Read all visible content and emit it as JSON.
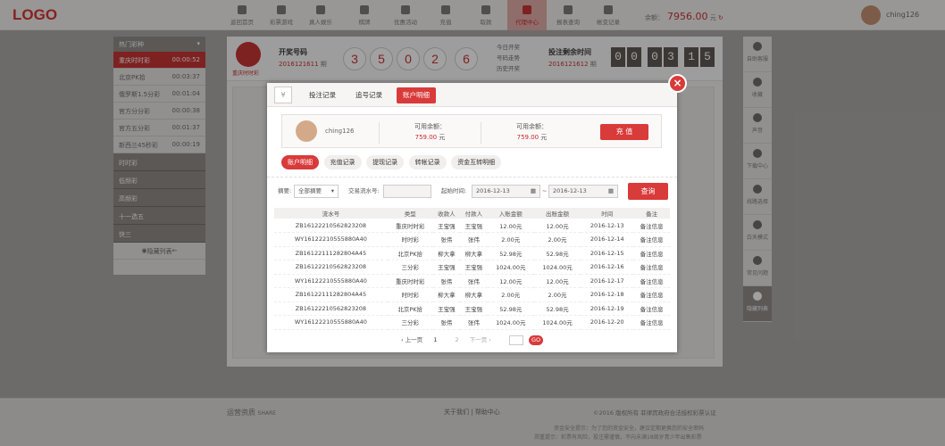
{
  "header": {
    "logo": "LOGO",
    "nav": [
      {
        "label": "返回首页"
      },
      {
        "label": "彩票游戏"
      },
      {
        "label": "真人娱乐"
      },
      {
        "label": "棋牌"
      },
      {
        "label": "优惠活动"
      },
      {
        "label": "充值"
      },
      {
        "label": "取款"
      },
      {
        "label": "代理中心",
        "active": true
      },
      {
        "label": "报表查询"
      },
      {
        "label": "帐变记录"
      }
    ],
    "balance_label": "余额：",
    "balance_value": "7956.00",
    "balance_unit": "元",
    "username": "ching126"
  },
  "sidebar": {
    "title": "热门彩种",
    "games": [
      {
        "name": "重庆时时彩",
        "time": "00:00:52",
        "active": true
      },
      {
        "name": "北京PK拾",
        "time": "00:03:37"
      },
      {
        "name": "俄罗斯1.5分彩",
        "time": "00:01:04"
      },
      {
        "name": "官方分分彩",
        "time": "00:00:38"
      },
      {
        "name": "官方五分彩",
        "time": "00:01:37"
      },
      {
        "name": "新西兰45秒彩",
        "time": "00:00:19"
      }
    ],
    "groups": [
      "时时彩",
      "低频彩",
      "高频彩",
      "十一选五",
      "快三"
    ],
    "hide_label": "隐藏列表"
  },
  "issue": {
    "game_name": "重庆时时彩",
    "draw_title": "开奖号码",
    "draw_no": "2016121611",
    "period": "期",
    "balls": [
      "3",
      "5",
      "0",
      "2",
      "6"
    ],
    "links": [
      "今日开奖",
      "号码走势",
      "历史开奖"
    ],
    "countdown_title": "投注剩余时间",
    "countdown_no": "2016121612",
    "countdown_period": "期",
    "countdown_digits": [
      "0",
      "0",
      "0",
      "3",
      "1",
      "5"
    ]
  },
  "right_panel": [
    {
      "label": "自助客服"
    },
    {
      "label": "收藏"
    },
    {
      "label": "声音"
    },
    {
      "label": "下载中心"
    },
    {
      "label": "线路选择"
    },
    {
      "label": "白天模式"
    },
    {
      "label": "常见问题"
    },
    {
      "label": "隐藏列表",
      "active": true
    }
  ],
  "modal": {
    "tabs": [
      {
        "label": "投注记录"
      },
      {
        "label": "追号记录"
      },
      {
        "label": "账户明细",
        "active": true
      }
    ],
    "close": "×",
    "account": {
      "name": "ching126",
      "available_label": "可用余额：",
      "available_value": "759.00",
      "unit": "元",
      "available2_label": "可用余额：",
      "available2_value": "759.00",
      "recharge_btn": "充 值"
    },
    "sub_tabs": [
      {
        "label": "账户明细",
        "active": true
      },
      {
        "label": "充值记录"
      },
      {
        "label": "提现记录"
      },
      {
        "label": "转帐记录"
      },
      {
        "label": "资金互转明细"
      }
    ],
    "filter": {
      "summary_label": "摘要:",
      "summary_value": "全部摘要",
      "txn_label": "交易流水号:",
      "date_label": "起始时间:",
      "date_from": "2016-12-13",
      "date_sep": "~",
      "date_to": "2016-12-13",
      "query_btn": "查询"
    },
    "table": {
      "headers": [
        "流水号",
        "类型",
        "收款人",
        "付款人",
        "入账金额",
        "出账金额",
        "时间",
        "备注"
      ],
      "rows": [
        [
          "ZB16122210562823208",
          "重庆时时彩",
          "王宝强",
          "王宝强",
          "12.00元",
          "12.00元",
          "2016-12-13",
          "备注信息"
        ],
        [
          "WY16122210555880A40",
          "时时彩",
          "张伟",
          "张伟",
          "2.00元",
          "2.00元",
          "2016-12-14",
          "备注信息"
        ],
        [
          "ZB16122111282804A45",
          "北京PK拾",
          "柳大拿",
          "柳大拿",
          "52.98元",
          "52.98元",
          "2016-12-15",
          "备注信息"
        ],
        [
          "ZB16122210562823208",
          "三分彩",
          "王宝强",
          "王宝强",
          "1024.00元",
          "1024.00元",
          "2016-12-16",
          "备注信息"
        ],
        [
          "WY16122210555880A40",
          "重庆时时彩",
          "张伟",
          "张伟",
          "12.00元",
          "12.00元",
          "2016-12-17",
          "备注信息"
        ],
        [
          "ZB16122111282804A45",
          "时时彩",
          "柳大拿",
          "柳大拿",
          "2.00元",
          "2.00元",
          "2016-12-18",
          "备注信息"
        ],
        [
          "ZB16122210562823208",
          "北京PK拾",
          "王宝强",
          "王宝强",
          "52.98元",
          "52.98元",
          "2016-12-19",
          "备注信息"
        ],
        [
          "WY16122210555880A40",
          "三分彩",
          "张伟",
          "张伟",
          "1024.00元",
          "1024.00元",
          "2016-12-20",
          "备注信息"
        ]
      ]
    },
    "pagination": {
      "prev": "‹ 上一页",
      "pages": [
        "1",
        "2"
      ],
      "next": "下一页 ›",
      "go": "GO"
    }
  },
  "footer": {
    "partners_title": "运营资质",
    "partners_sub": "SHARE",
    "links": [
      "关于我们",
      "帮助中心"
    ],
    "copyright": "©2016 版权所有 菲律宾政府合法授权彩票认证",
    "notice1": "资金安全提示：为了您的资金安全，建议定期更换您的安全密码",
    "notice2": "郑重提示：彩票有风险，投注需谨慎，不向未满18周岁青少年出售彩票"
  }
}
